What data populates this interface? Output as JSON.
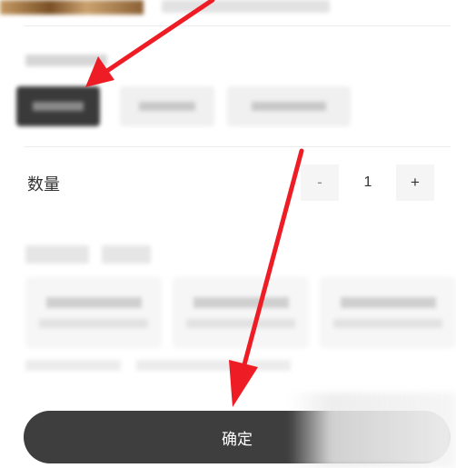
{
  "quantity": {
    "label": "数量",
    "minus": "-",
    "value": "1",
    "plus": "+"
  },
  "confirm": {
    "label": "确定"
  },
  "annotation": {
    "arrow_color": "#ee1c24"
  },
  "colors": {
    "button_bg": "#3e3e3e",
    "selected_chip": "#3a3a3a"
  }
}
